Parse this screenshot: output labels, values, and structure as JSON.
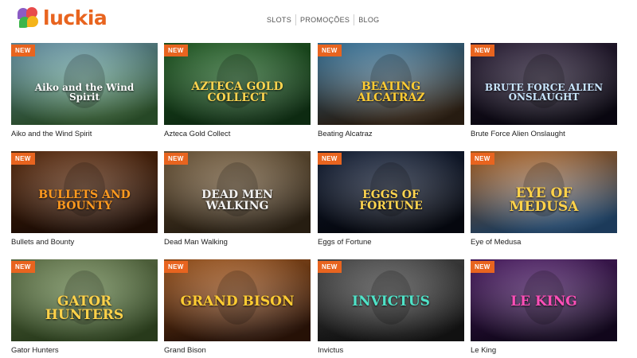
{
  "brand": {
    "logo_text": "luckia",
    "accent": "#e8641f"
  },
  "nav": {
    "items": [
      "SLOTS",
      "PROMOÇÕES",
      "BLOG"
    ]
  },
  "badge_label": "NEW",
  "games": [
    {
      "name": "Aiko and the Wind Spirit",
      "art_title": "Aiko and the Wind Spirit",
      "bg": [
        "#8ecae6",
        "#3b6e3a"
      ],
      "title_color": "#ffffff"
    },
    {
      "name": "Azteca Gold Collect",
      "art_title": "AZTECA GOLD COLLECT",
      "bg": [
        "#2e7d32",
        "#14401a"
      ],
      "title_color": "#ffd54f"
    },
    {
      "name": "Beating Alcatraz",
      "art_title": "BEATING ALCATRAZ",
      "bg": [
        "#4fa3d9",
        "#3b2a1a"
      ],
      "title_color": "#ffcc33"
    },
    {
      "name": "Brute Force Alien Onslaught",
      "art_title": "BRUTE FORCE ALIEN ONSLAUGHT",
      "bg": [
        "#3a2a4a",
        "#0e0a18"
      ],
      "title_color": "#c9e6ff"
    },
    {
      "name": "Bullets and Bounty",
      "art_title": "BULLETS AND BOUNTY",
      "bg": [
        "#7a3a12",
        "#2a1206"
      ],
      "title_color": "#ff9a1f"
    },
    {
      "name": "Dead Man Walking",
      "art_title": "DEAD MEN WALKING",
      "bg": [
        "#9a7b52",
        "#3a2c1a"
      ],
      "title_color": "#f2f2f2"
    },
    {
      "name": "Eggs of Fortune",
      "art_title": "EGGS OF FORTUNE",
      "bg": [
        "#1c2b4a",
        "#070b16"
      ],
      "title_color": "#ffd54f"
    },
    {
      "name": "Eye of Medusa",
      "art_title": "EYE OF MEDUSA",
      "bg": [
        "#e9822a",
        "#2b5a8a"
      ],
      "title_color": "#ffd24a"
    },
    {
      "name": "Gator Hunters",
      "art_title": "GATOR HUNTERS",
      "bg": [
        "#8aa56a",
        "#3e5a2a"
      ],
      "title_color": "#ffd24a"
    },
    {
      "name": "Grand Bison",
      "art_title": "GRAND BISON",
      "bg": [
        "#d8762a",
        "#3a1a0a"
      ],
      "title_color": "#ffcc33"
    },
    {
      "name": "Invictus",
      "art_title": "INVICTUS",
      "bg": [
        "#6a6a6a",
        "#1a1a1a"
      ],
      "title_color": "#4fe3c8"
    },
    {
      "name": "Le King",
      "art_title": "LE KING",
      "bg": [
        "#6a2a8a",
        "#1a0a2a"
      ],
      "title_color": "#ff4fb8"
    }
  ]
}
